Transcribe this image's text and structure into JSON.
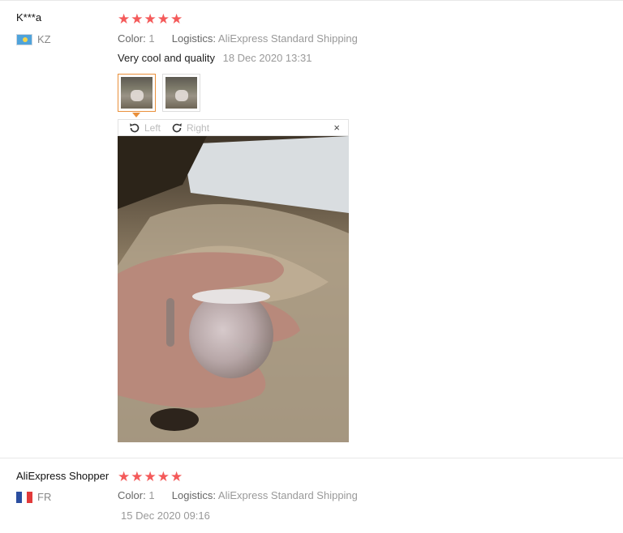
{
  "reviews": [
    {
      "name": "K***a",
      "country": "KZ",
      "stars": 5,
      "color_label": "Color:",
      "color_value": "1",
      "logistics_label": "Logistics:",
      "logistics_value": "AliExpress Standard Shipping",
      "text": "Very cool and quality",
      "date": "18 Dec 2020 13:31",
      "viewer": {
        "left_label": "Left",
        "right_label": "Right",
        "close_label": "×"
      }
    },
    {
      "name": "AliExpress Shopper",
      "country": "FR",
      "stars": 5,
      "color_label": "Color:",
      "color_value": "1",
      "logistics_label": "Logistics:",
      "logistics_value": "AliExpress Standard Shipping",
      "date": "15 Dec 2020 09:16"
    }
  ],
  "icons": {
    "star": "★",
    "rotate_left": "rotate-left-icon",
    "rotate_right": "rotate-right-icon",
    "close": "close-icon"
  },
  "colors": {
    "star": "#f45a5a",
    "active_thumb_border": "#e98f3a",
    "muted_text": "#999999"
  }
}
